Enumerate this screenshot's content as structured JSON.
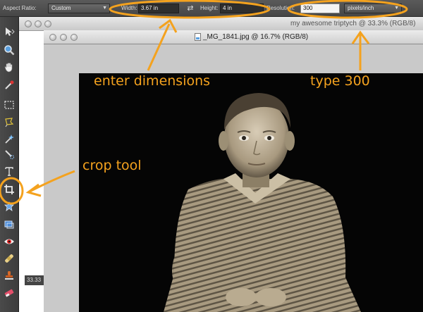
{
  "options_bar": {
    "aspect_ratio_label": "Aspect Ratio:",
    "aspect_ratio_value": "Custom",
    "width_label": "Width:",
    "width_value": "3.67 in",
    "height_label": "Height:",
    "height_value": "4 in",
    "resolution_label": "Resolution:",
    "resolution_value": "300",
    "resolution_unit": "pixels/inch"
  },
  "windows": {
    "back_title": "my awesome triptych @ 33.3% (RGB/8)",
    "back_zoom": "33.33",
    "front_title": "_MG_1841.jpg @ 16.7% (RGB/8)"
  },
  "annotations": {
    "enter_dimensions": "enter dimensions",
    "type_300": "type 300",
    "crop_tool": "crop tool"
  },
  "colors": {
    "annotation": "#f4a21e"
  }
}
